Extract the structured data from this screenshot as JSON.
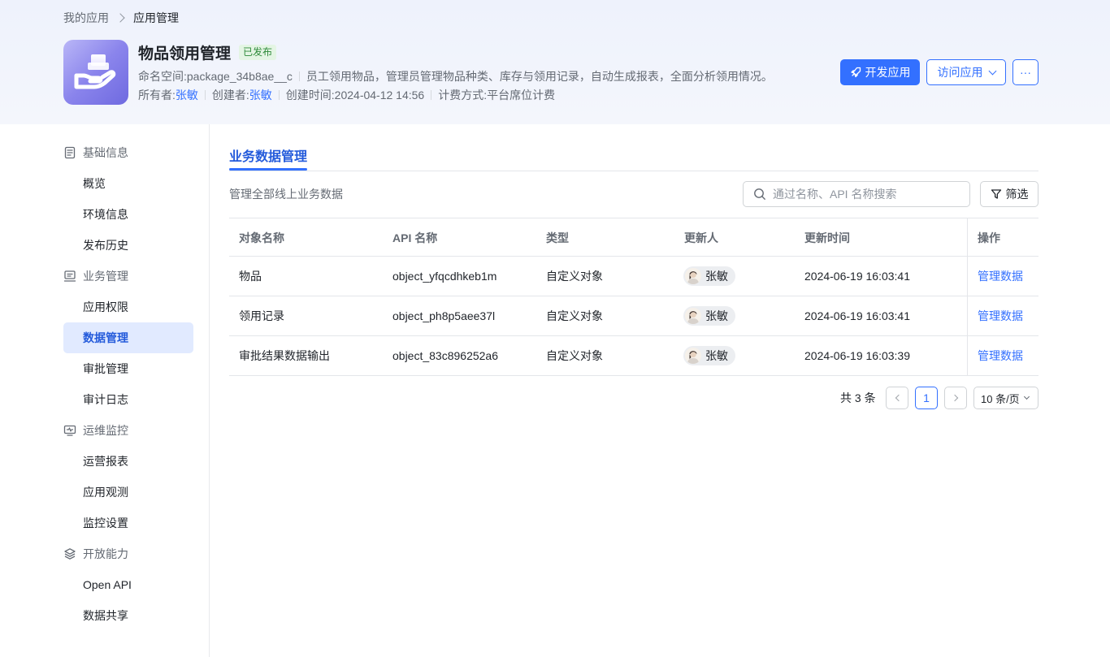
{
  "breadcrumb": {
    "parent": "我的应用",
    "current": "应用管理"
  },
  "app": {
    "title": "物品领用管理",
    "status": "已发布",
    "namespace_label": "命名空间:",
    "namespace_value": "package_34b8ae__c",
    "description": "员工领用物品，管理员管理物品种类、库存与领用记录，自动生成报表，全面分析领用情况。",
    "owner_label": "所有者:",
    "owner": "张敏",
    "creator_label": "创建者:",
    "creator": "张敏",
    "created_label": "创建时间:",
    "created": "2024-04-12 14:56",
    "billing_label": "计费方式:",
    "billing": "平台席位计费"
  },
  "actions": {
    "develop": "开发应用",
    "visit": "访问应用",
    "more": "···"
  },
  "sidebar": {
    "groups": [
      {
        "label": "基础信息",
        "icon": "document-icon",
        "items": [
          "概览",
          "环境信息",
          "发布历史"
        ]
      },
      {
        "label": "业务管理",
        "icon": "business-icon",
        "items": [
          "应用权限",
          "数据管理",
          "审批管理",
          "审计日志"
        ]
      },
      {
        "label": "运维监控",
        "icon": "monitor-icon",
        "items": [
          "运营报表",
          "应用观测",
          "监控设置"
        ]
      },
      {
        "label": "开放能力",
        "icon": "layers-icon",
        "items": [
          "Open API",
          "数据共享"
        ]
      }
    ],
    "active": "数据管理"
  },
  "main": {
    "tab": "业务数据管理",
    "description": "管理全部线上业务数据",
    "search_placeholder": "通过名称、API 名称搜索",
    "filter_label": "筛选",
    "table": {
      "headers": [
        "对象名称",
        "API 名称",
        "类型",
        "更新人",
        "更新时间",
        "操作"
      ],
      "rows": [
        {
          "name": "物品",
          "api": "object_yfqcdhkeb1m",
          "type": "自定义对象",
          "updater": "张敏",
          "updated": "2024-06-19 16:03:41",
          "action": "管理数据"
        },
        {
          "name": "领用记录",
          "api": "object_ph8p5aee37l",
          "type": "自定义对象",
          "updater": "张敏",
          "updated": "2024-06-19 16:03:41",
          "action": "管理数据"
        },
        {
          "name": "审批结果数据输出",
          "api": "object_83c896252a6",
          "type": "自定义对象",
          "updater": "张敏",
          "updated": "2024-06-19 16:03:39",
          "action": "管理数据"
        }
      ]
    },
    "pagination": {
      "total": "共 3 条",
      "current_page": "1",
      "page_size": "10 条/页"
    }
  },
  "colors": {
    "primary": "#3370ff",
    "active_bg": "#e1eaff",
    "published_bg": "#e4f5e4"
  }
}
